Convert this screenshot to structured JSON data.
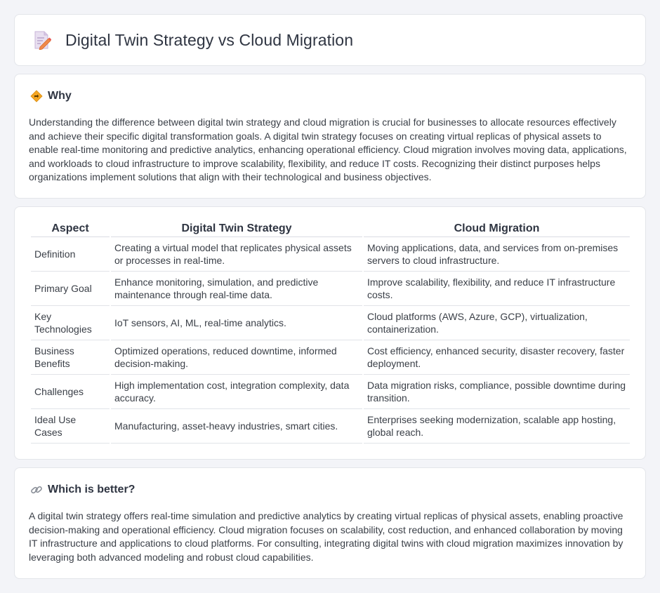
{
  "header": {
    "title": "Digital Twin Strategy vs Cloud Migration",
    "icon": "document-pencil-icon"
  },
  "why": {
    "icon": "diamond-sign-icon",
    "title": "Why",
    "text": "Understanding the difference between digital twin strategy and cloud migration is crucial for businesses to allocate resources effectively and achieve their specific digital transformation goals. A digital twin strategy focuses on creating virtual replicas of physical assets to enable real-time monitoring and predictive analytics, enhancing operational efficiency. Cloud migration involves moving data, applications, and workloads to cloud infrastructure to improve scalability, flexibility, and reduce IT costs. Recognizing their distinct purposes helps organizations implement solutions that align with their technological and business objectives."
  },
  "table": {
    "headers": [
      "Aspect",
      "Digital Twin Strategy",
      "Cloud Migration"
    ],
    "rows": [
      [
        "Definition",
        "Creating a virtual model that replicates physical assets or processes in real-time.",
        "Moving applications, data, and services from on-premises servers to cloud infrastructure."
      ],
      [
        "Primary Goal",
        "Enhance monitoring, simulation, and predictive maintenance through real-time data.",
        "Improve scalability, flexibility, and reduce IT infrastructure costs."
      ],
      [
        "Key Technologies",
        "IoT sensors, AI, ML, real-time analytics.",
        "Cloud platforms (AWS, Azure, GCP), virtualization, containerization."
      ],
      [
        "Business Benefits",
        "Optimized operations, reduced downtime, informed decision-making.",
        "Cost efficiency, enhanced security, disaster recovery, faster deployment."
      ],
      [
        "Challenges",
        "High implementation cost, integration complexity, data accuracy.",
        "Data migration risks, compliance, possible downtime during transition."
      ],
      [
        "Ideal Use Cases",
        "Manufacturing, asset-heavy industries, smart cities.",
        "Enterprises seeking modernization, scalable app hosting, global reach."
      ]
    ]
  },
  "better": {
    "icon": "link-icon",
    "title": "Which is better?",
    "text": "A digital twin strategy offers real-time simulation and predictive analytics by creating virtual replicas of physical assets, enabling proactive decision-making and operational efficiency. Cloud migration focuses on scalability, cost reduction, and enhanced collaboration by moving IT infrastructure and applications to cloud platforms. For consulting, integrating digital twins with cloud migration maximizes innovation by leveraging both advanced modeling and robust cloud capabilities."
  }
}
